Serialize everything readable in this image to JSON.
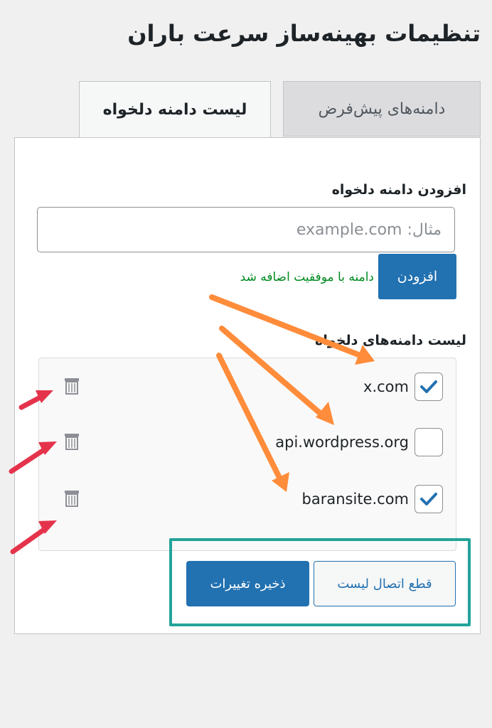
{
  "page": {
    "title": "تنظیمات بهینه‌ساز سرعت باران"
  },
  "tabs": [
    {
      "label": "دامنه‌های پیش‌فرض",
      "active": false
    },
    {
      "label": "لیست دامنه دلخواه",
      "active": true
    }
  ],
  "add_section": {
    "label": "افزودن دامنه دلخواه",
    "placeholder": "مثال: example.com",
    "add_button": "افزودن",
    "success_message": "دامنه با موفقیت اضافه شد"
  },
  "list_section": {
    "label": "لیست دامنه‌های دلخواه",
    "items": [
      {
        "domain": "x.com",
        "checked": true,
        "delete_icon": "trash-icon"
      },
      {
        "domain": "api.wordpress.org",
        "checked": false,
        "delete_icon": "trash-icon"
      },
      {
        "domain": "baransite.com",
        "checked": true,
        "delete_icon": "trash-icon"
      }
    ]
  },
  "actions": {
    "save_button": "ذخیره تغییرات",
    "disconnect_button": "قطع اتصال لیست"
  },
  "colors": {
    "primary": "#2271b1",
    "success": "#008a20",
    "arrow_orange": "#ff8c3a",
    "arrow_red": "#e5334b",
    "highlight_teal": "#23a39a"
  }
}
